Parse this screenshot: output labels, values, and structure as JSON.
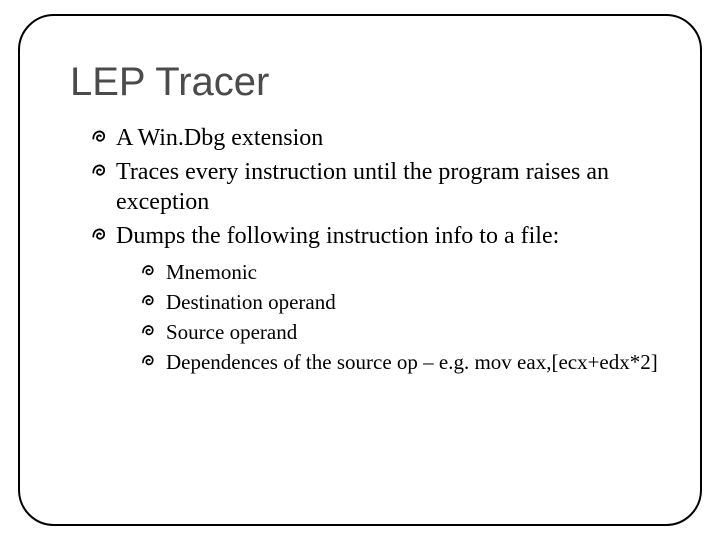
{
  "title": "LEP Tracer",
  "bullets": [
    "A Win.Dbg extension",
    "Traces every instruction until the program raises an exception",
    "Dumps the following instruction info to a file:"
  ],
  "subbullets": [
    "Mnemonic",
    "Destination operand",
    "Source operand",
    "Dependences of the source op – e.g. mov eax,[ecx+edx*2]"
  ]
}
